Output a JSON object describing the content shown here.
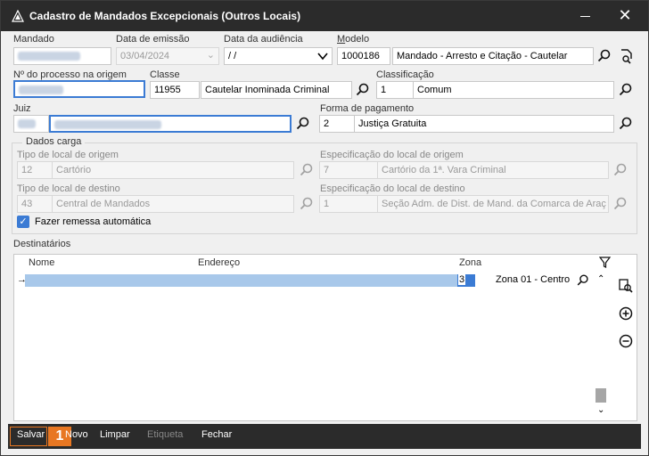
{
  "window": {
    "title": "Cadastro de Mandados Excepcionais (Outros Locais)",
    "close_glyph": "✕"
  },
  "form": {
    "mandado": {
      "label": "Mandado"
    },
    "data_emissao": {
      "label": "Data de emissão",
      "value": "03/04/2024"
    },
    "data_audiencia": {
      "label": "Data da audiência",
      "value": " /  /"
    },
    "modelo": {
      "label": "Modelo",
      "code": "1000186",
      "desc": "Mandado - Arresto e Citação - Cautelar"
    },
    "processo": {
      "label": "Nº do processo na origem"
    },
    "classe": {
      "label": "Classe",
      "code": "11955",
      "desc": "Cautelar Inominada Criminal"
    },
    "classificacao": {
      "label": "Classificação",
      "code": "1",
      "desc": "Comum"
    },
    "juiz": {
      "label": "Juiz"
    },
    "forma_pagamento": {
      "label": "Forma de pagamento",
      "code": "2",
      "desc": "Justiça Gratuita"
    }
  },
  "dados_carga": {
    "title": "Dados carga",
    "tipo_origem": {
      "label": "Tipo de local de origem",
      "code": "12",
      "desc": "Cartório"
    },
    "espec_origem": {
      "label": "Especificação do local de origem",
      "code": "7",
      "desc": "Cartório da 1ª. Vara Criminal"
    },
    "tipo_destino": {
      "label": "Tipo de local de destino",
      "code": "43",
      "desc": "Central de Mandados"
    },
    "espec_destino": {
      "label": "Especificação do local de destino",
      "code": "1",
      "desc": "Seção Adm. de Dist. de Mand. da Comarca de Araç"
    },
    "remessa": {
      "label": "Fazer remessa automática",
      "checked": true
    }
  },
  "destinatarios": {
    "label": "Destinatários",
    "columns": [
      "Nome",
      "Endereço",
      "Zona"
    ],
    "rows": [
      {
        "zona_code": "3",
        "zona_desc": "Zona 01 - Centro"
      }
    ]
  },
  "footer": {
    "buttons": [
      "Salvar",
      "Novo",
      "Limpar",
      "Etiqueta",
      "Fechar"
    ],
    "badge": "1"
  },
  "colors": {
    "accent": "#3b7bd4",
    "titlebar": "#2b2b2b",
    "badge": "#e87722"
  }
}
